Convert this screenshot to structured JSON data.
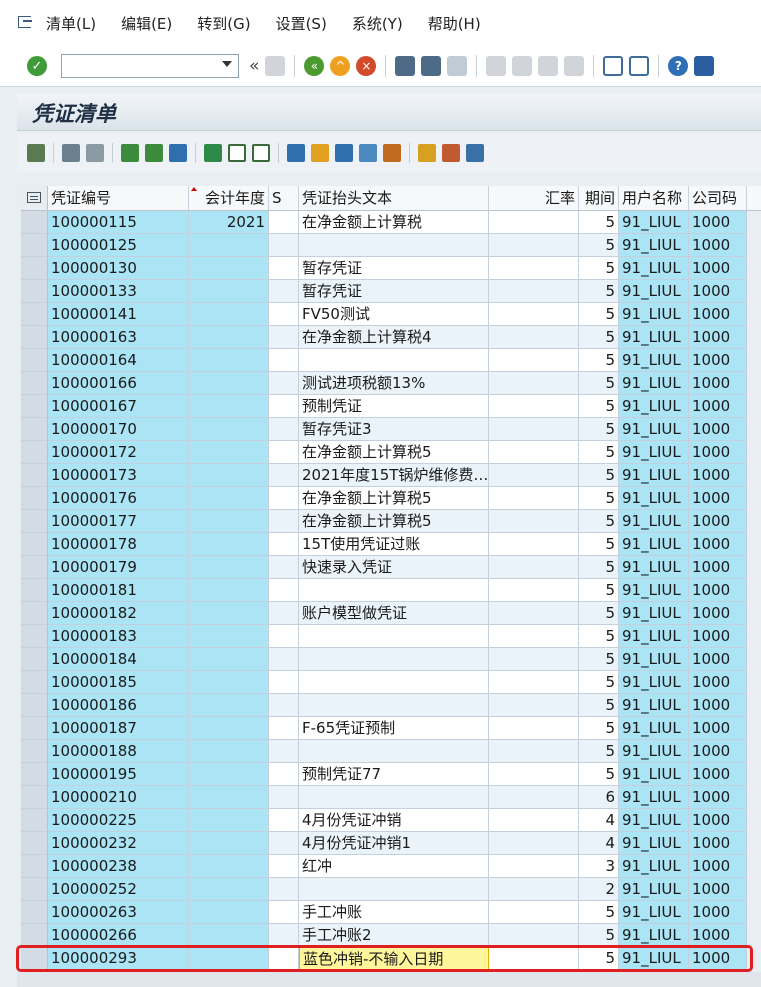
{
  "menu": {
    "items": [
      "清单(L)",
      "编辑(E)",
      "转到(G)",
      "设置(S)",
      "系统(Y)",
      "帮助(H)"
    ]
  },
  "toolbar": {
    "command_value": "",
    "icons": [
      "enter-icon",
      "back-icon",
      "save-icon",
      "back-nav-icon",
      "exit-icon",
      "cancel-icon",
      "print-icon",
      "find-icon",
      "find-next-icon",
      "first-page-icon",
      "prev-page-icon",
      "next-page-icon",
      "last-page-icon",
      "new-session-icon",
      "shortcut-icon",
      "help-icon",
      "customize-icon"
    ]
  },
  "title": "凭证清单",
  "grid": {
    "columns": {
      "doc_no": "凭证编号",
      "year": "会计年度",
      "s": "S",
      "header_text": "凭证抬头文本",
      "rate": "汇率",
      "period": "期间",
      "user": "用户名称",
      "company": "公司码"
    },
    "rows": [
      {
        "doc_no": "100000115",
        "year": "2021",
        "s": "",
        "header_text": "在净金额上计算税",
        "rate": "",
        "period": "5",
        "user": "91_LIUL",
        "company": "1000"
      },
      {
        "doc_no": "100000125",
        "year": "",
        "s": "",
        "header_text": "",
        "rate": "",
        "period": "5",
        "user": "91_LIUL",
        "company": "1000"
      },
      {
        "doc_no": "100000130",
        "year": "",
        "s": "",
        "header_text": "暂存凭证",
        "rate": "",
        "period": "5",
        "user": "91_LIUL",
        "company": "1000"
      },
      {
        "doc_no": "100000133",
        "year": "",
        "s": "",
        "header_text": "暂存凭证",
        "rate": "",
        "period": "5",
        "user": "91_LIUL",
        "company": "1000"
      },
      {
        "doc_no": "100000141",
        "year": "",
        "s": "",
        "header_text": "FV50测试",
        "rate": "",
        "period": "5",
        "user": "91_LIUL",
        "company": "1000"
      },
      {
        "doc_no": "100000163",
        "year": "",
        "s": "",
        "header_text": "在净金额上计算税4",
        "rate": "",
        "period": "5",
        "user": "91_LIUL",
        "company": "1000"
      },
      {
        "doc_no": "100000164",
        "year": "",
        "s": "",
        "header_text": "",
        "rate": "",
        "period": "5",
        "user": "91_LIUL",
        "company": "1000"
      },
      {
        "doc_no": "100000166",
        "year": "",
        "s": "",
        "header_text": "测试进项税额13%",
        "rate": "",
        "period": "5",
        "user": "91_LIUL",
        "company": "1000"
      },
      {
        "doc_no": "100000167",
        "year": "",
        "s": "",
        "header_text": "预制凭证",
        "rate": "",
        "period": "5",
        "user": "91_LIUL",
        "company": "1000"
      },
      {
        "doc_no": "100000170",
        "year": "",
        "s": "",
        "header_text": "暂存凭证3",
        "rate": "",
        "period": "5",
        "user": "91_LIUL",
        "company": "1000"
      },
      {
        "doc_no": "100000172",
        "year": "",
        "s": "",
        "header_text": "在净金额上计算税5",
        "rate": "",
        "period": "5",
        "user": "91_LIUL",
        "company": "1000"
      },
      {
        "doc_no": "100000173",
        "year": "",
        "s": "",
        "header_text": "2021年度15T锅炉维修费…",
        "rate": "",
        "period": "5",
        "user": "91_LIUL",
        "company": "1000"
      },
      {
        "doc_no": "100000176",
        "year": "",
        "s": "",
        "header_text": "在净金额上计算税5",
        "rate": "",
        "period": "5",
        "user": "91_LIUL",
        "company": "1000"
      },
      {
        "doc_no": "100000177",
        "year": "",
        "s": "",
        "header_text": "在净金额上计算税5",
        "rate": "",
        "period": "5",
        "user": "91_LIUL",
        "company": "1000"
      },
      {
        "doc_no": "100000178",
        "year": "",
        "s": "",
        "header_text": "15T使用凭证过账",
        "rate": "",
        "period": "5",
        "user": "91_LIUL",
        "company": "1000"
      },
      {
        "doc_no": "100000179",
        "year": "",
        "s": "",
        "header_text": "快速录入凭证",
        "rate": "",
        "period": "5",
        "user": "91_LIUL",
        "company": "1000"
      },
      {
        "doc_no": "100000181",
        "year": "",
        "s": "",
        "header_text": "",
        "rate": "",
        "period": "5",
        "user": "91_LIUL",
        "company": "1000"
      },
      {
        "doc_no": "100000182",
        "year": "",
        "s": "",
        "header_text": "账户模型做凭证",
        "rate": "",
        "period": "5",
        "user": "91_LIUL",
        "company": "1000"
      },
      {
        "doc_no": "100000183",
        "year": "",
        "s": "",
        "header_text": "",
        "rate": "",
        "period": "5",
        "user": "91_LIUL",
        "company": "1000"
      },
      {
        "doc_no": "100000184",
        "year": "",
        "s": "",
        "header_text": "",
        "rate": "",
        "period": "5",
        "user": "91_LIUL",
        "company": "1000"
      },
      {
        "doc_no": "100000185",
        "year": "",
        "s": "",
        "header_text": "",
        "rate": "",
        "period": "5",
        "user": "91_LIUL",
        "company": "1000"
      },
      {
        "doc_no": "100000186",
        "year": "",
        "s": "",
        "header_text": "",
        "rate": "",
        "period": "5",
        "user": "91_LIUL",
        "company": "1000"
      },
      {
        "doc_no": "100000187",
        "year": "",
        "s": "",
        "header_text": "F-65凭证预制",
        "rate": "",
        "period": "5",
        "user": "91_LIUL",
        "company": "1000"
      },
      {
        "doc_no": "100000188",
        "year": "",
        "s": "",
        "header_text": "",
        "rate": "",
        "period": "5",
        "user": "91_LIUL",
        "company": "1000"
      },
      {
        "doc_no": "100000195",
        "year": "",
        "s": "",
        "header_text": "预制凭证77",
        "rate": "",
        "period": "5",
        "user": "91_LIUL",
        "company": "1000"
      },
      {
        "doc_no": "100000210",
        "year": "",
        "s": "",
        "header_text": "",
        "rate": "",
        "period": "6",
        "user": "91_LIUL",
        "company": "1000"
      },
      {
        "doc_no": "100000225",
        "year": "",
        "s": "",
        "header_text": "4月份凭证冲销",
        "rate": "",
        "period": "4",
        "user": "91_LIUL",
        "company": "1000"
      },
      {
        "doc_no": "100000232",
        "year": "",
        "s": "",
        "header_text": "4月份凭证冲销1",
        "rate": "",
        "period": "4",
        "user": "91_LIUL",
        "company": "1000"
      },
      {
        "doc_no": "100000238",
        "year": "",
        "s": "",
        "header_text": "红冲",
        "rate": "",
        "period": "3",
        "user": "91_LIUL",
        "company": "1000"
      },
      {
        "doc_no": "100000252",
        "year": "",
        "s": "",
        "header_text": "",
        "rate": "",
        "period": "2",
        "user": "91_LIUL",
        "company": "1000"
      },
      {
        "doc_no": "100000263",
        "year": "",
        "s": "",
        "header_text": "手工冲账",
        "rate": "",
        "period": "5",
        "user": "91_LIUL",
        "company": "1000"
      },
      {
        "doc_no": "100000266",
        "year": "",
        "s": "",
        "header_text": "手工冲账2",
        "rate": "",
        "period": "5",
        "user": "91_LIUL",
        "company": "1000"
      },
      {
        "doc_no": "100000293",
        "year": "",
        "s": "",
        "header_text": "蓝色冲销-不输入日期",
        "rate": "",
        "period": "5",
        "user": "91_LIUL",
        "company": "1000"
      }
    ]
  },
  "colors": {
    "key_column": "#abe4f4",
    "highlight_border": "#e02020",
    "focus_cell": "#fff59a"
  }
}
